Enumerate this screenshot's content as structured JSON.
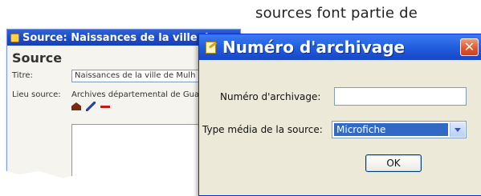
{
  "caption": "sources font partie de",
  "background_window": {
    "title": "Source: Naissances de la ville d",
    "heading": "Source",
    "titre_label": "Titre:",
    "titre_value": "Naissances de la ville de Mulh",
    "lieu_label": "Lieu source:",
    "lieu_value": "Archives départemental de Gua",
    "tools": [
      "house-icon",
      "pen-icon",
      "minus-icon"
    ]
  },
  "dialog": {
    "title": "Numéro d'archivage",
    "close_label": "✕",
    "numero_label": "Numéro d'archivage:",
    "numero_value": "",
    "type_label": "Type média de la source:",
    "type_value": "Microfiche",
    "ok_label": "OK"
  },
  "colors": {
    "titlebar_blue": "#2361e0",
    "selection_blue": "#316ac5",
    "close_red": "#de5a2e",
    "dialog_bg": "#ece9d8"
  }
}
